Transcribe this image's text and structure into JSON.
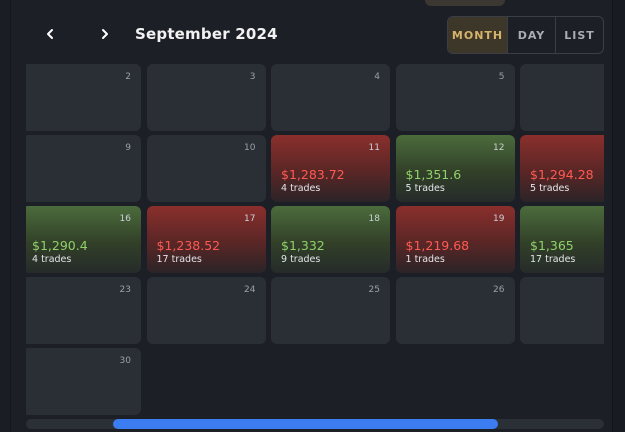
{
  "header": {
    "month_title": "September 2024",
    "prev_icon": "chevron-left-icon",
    "next_icon": "chevron-right-icon",
    "views": [
      {
        "label": "MONTH",
        "active": true
      },
      {
        "label": "DAY",
        "active": false
      },
      {
        "label": "LIST",
        "active": false
      }
    ]
  },
  "colors": {
    "background": "#1c1f26",
    "cell": "#2a2e35",
    "profit_text": "#8fd16a",
    "loss_text": "#ff5a52",
    "active_view_text": "#d6b36a",
    "scroll_thumb": "#3b7cf0"
  },
  "calendar": {
    "weeks": [
      [
        {
          "day": "2"
        },
        {
          "day": "3"
        },
        {
          "day": "4"
        },
        {
          "day": "5"
        },
        {
          "day": ""
        }
      ],
      [
        {
          "day": "9"
        },
        {
          "day": "10"
        },
        {
          "day": "11",
          "pnl": "$1,283.72",
          "trades": "4 trades",
          "status": "loss"
        },
        {
          "day": "12",
          "pnl": "$1,351.6",
          "trades": "5 trades",
          "status": "profit"
        },
        {
          "day": "",
          "pnl": "$1,294.28",
          "trades": "5 trades",
          "status": "loss"
        }
      ],
      [
        {
          "day": "16",
          "pnl": "$1,290.4",
          "trades": "4 trades",
          "status": "profit"
        },
        {
          "day": "17",
          "pnl": "$1,238.52",
          "trades": "17 trades",
          "status": "loss"
        },
        {
          "day": "18",
          "pnl": "$1,332",
          "trades": "9 trades",
          "status": "profit"
        },
        {
          "day": "19",
          "pnl": "$1,219.68",
          "trades": "1 trades",
          "status": "loss"
        },
        {
          "day": "",
          "pnl": "$1,365",
          "trades": "17 trades",
          "status": "profit"
        }
      ],
      [
        {
          "day": "23"
        },
        {
          "day": "24"
        },
        {
          "day": "25"
        },
        {
          "day": "26"
        },
        {
          "day": ""
        }
      ],
      [
        {
          "day": "30"
        }
      ]
    ]
  },
  "scrollbar": {
    "position": 0.15,
    "visible_fraction": 0.67
  }
}
